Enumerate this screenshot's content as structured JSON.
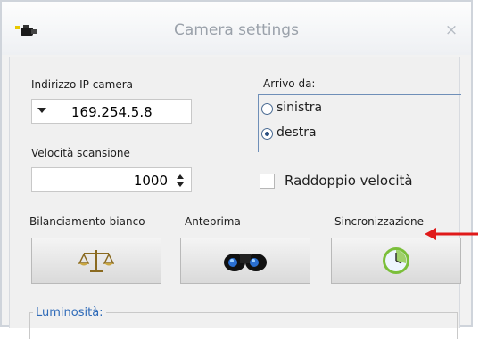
{
  "window": {
    "title": "Camera settings",
    "close_glyph": "×",
    "app_icon": "camera-icon"
  },
  "ip_camera": {
    "label": "Indirizzo IP camera",
    "value": "169.254.5.8"
  },
  "scan_speed": {
    "label": "Velocità scansione",
    "value": "1000"
  },
  "arrival": {
    "label": "Arrivo da:",
    "options": [
      {
        "label": "sinistra",
        "selected": false
      },
      {
        "label": "destra",
        "selected": true
      }
    ]
  },
  "double_speed": {
    "label": "Raddoppio velocità",
    "checked": false
  },
  "buttons": [
    {
      "label": "Bilanciamento bianco",
      "icon": "scales-icon"
    },
    {
      "label": "Anteprima",
      "icon": "binoculars-icon"
    },
    {
      "label": "Sincronizzazione",
      "icon": "clock-icon"
    }
  ],
  "brightness_group": {
    "title": "Luminosità:"
  },
  "colors": {
    "annotation_arrow": "#e01a1a",
    "group_title": "#2e6ab8",
    "accent_border": "#6f8fb8"
  }
}
